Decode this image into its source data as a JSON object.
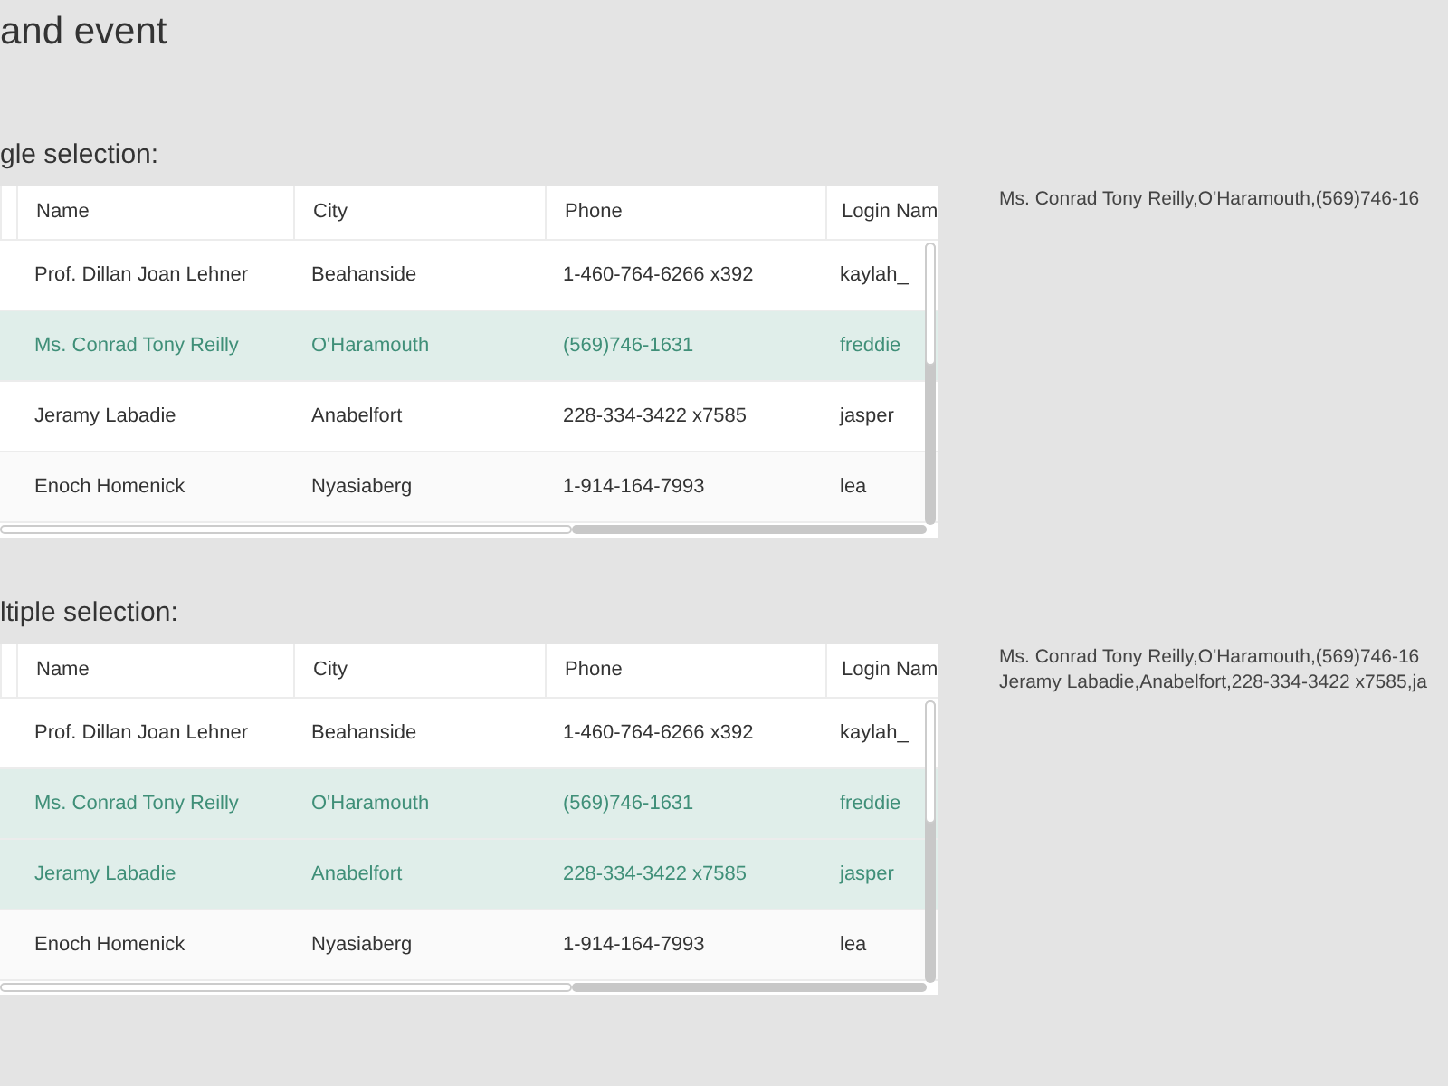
{
  "page_title": "and event",
  "grids": [
    {
      "label": "gle selection:",
      "columns": [
        "Name",
        "City",
        "Phone",
        "Login Nam"
      ],
      "rows": [
        {
          "cells": [
            "Prof. Dillan Joan Lehner",
            "Beahanside",
            "1-460-764-6266 x392",
            "kaylah_"
          ],
          "selected": false
        },
        {
          "cells": [
            "Ms. Conrad Tony Reilly",
            "O'Haramouth",
            "(569)746-1631",
            "freddie"
          ],
          "selected": true
        },
        {
          "cells": [
            "Jeramy Labadie",
            "Anabelfort",
            "228-334-3422 x7585",
            "jasper"
          ],
          "selected": false
        },
        {
          "cells": [
            "Enoch Homenick",
            "Nyasiaberg",
            "1-914-164-7993",
            "lea"
          ],
          "selected": false
        }
      ],
      "output": [
        "Ms. Conrad Tony Reilly,O'Haramouth,(569)746-16"
      ]
    },
    {
      "label": "ltiple selection:",
      "columns": [
        "Name",
        "City",
        "Phone",
        "Login Nam"
      ],
      "rows": [
        {
          "cells": [
            "Prof. Dillan Joan Lehner",
            "Beahanside",
            "1-460-764-6266 x392",
            "kaylah_"
          ],
          "selected": false
        },
        {
          "cells": [
            "Ms. Conrad Tony Reilly",
            "O'Haramouth",
            "(569)746-1631",
            "freddie"
          ],
          "selected": true
        },
        {
          "cells": [
            "Jeramy Labadie",
            "Anabelfort",
            "228-334-3422 x7585",
            "jasper"
          ],
          "selected": true
        },
        {
          "cells": [
            "Enoch Homenick",
            "Nyasiaberg",
            "1-914-164-7993",
            "lea"
          ],
          "selected": false
        }
      ],
      "output": [
        "Ms. Conrad Tony Reilly,O'Haramouth,(569)746-16",
        "Jeramy Labadie,Anabelfort,228-334-3422 x7585,ja"
      ]
    }
  ]
}
